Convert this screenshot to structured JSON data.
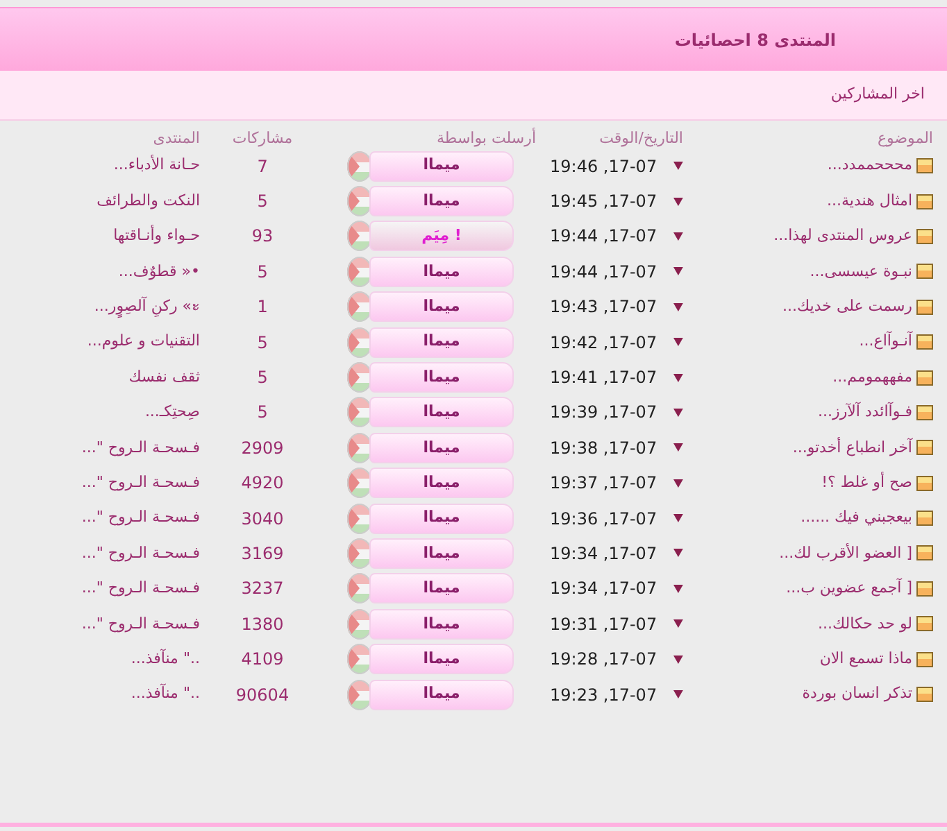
{
  "header": {
    "title": "المنتدى 8 احصائيات"
  },
  "subheader": {
    "title": "اخر المشاركين"
  },
  "table": {
    "columns": [
      "الموضوع",
      "التاريخ/الوقت",
      "أرسلت بواسطة",
      "مشاركات",
      "المنتدى"
    ],
    "rows": [
      {
        "topic": "محححممدد...",
        "date": "19:46 ,17-07",
        "user": {
          "name": "ميماا",
          "kind": "normal"
        },
        "posts": "7",
        "forum": "حـانة الأدباء..."
      },
      {
        "topic": "امثال هندية...",
        "date": "19:45 ,17-07",
        "user": {
          "name": "ميماا",
          "kind": "normal"
        },
        "posts": "5",
        "forum": "النكت والطرائف"
      },
      {
        "topic": "عروس المنتدى لهذا...",
        "date": "19:44 ,17-07",
        "user": {
          "name": "مِيَم !",
          "kind": "alt"
        },
        "posts": "93",
        "forum": "حـواء وأنـاقتها"
      },
      {
        "topic": "نبـوة عيسسى...",
        "date": "19:44 ,17-07",
        "user": {
          "name": "ميماا",
          "kind": "normal"
        },
        "posts": "5",
        "forum": "•« قطوٌف..."
      },
      {
        "topic": "رسمت على خديك...",
        "date": "19:43 ,17-07",
        "user": {
          "name": "ميماا",
          "kind": "normal"
        },
        "posts": "1",
        "forum": "ะ» رکنِ آلصِوٍر..."
      },
      {
        "topic": "آنـوآاع...",
        "date": "19:42 ,17-07",
        "user": {
          "name": "ميماا",
          "kind": "normal"
        },
        "posts": "5",
        "forum": "التقنيات و علوم..."
      },
      {
        "topic": "مفههمومم...",
        "date": "19:41 ,17-07",
        "user": {
          "name": "ميماا",
          "kind": "normal"
        },
        "posts": "5",
        "forum": "ثقف نفسك"
      },
      {
        "topic": "فـوآائدد آلآرز...",
        "date": "19:39 ,17-07",
        "user": {
          "name": "ميماا",
          "kind": "normal"
        },
        "posts": "5",
        "forum": "صِحتِكـ..."
      },
      {
        "topic": "آخر انطباع أخدتو...",
        "date": "19:38 ,17-07",
        "user": {
          "name": "ميماا",
          "kind": "normal"
        },
        "posts": "2909",
        "forum": "فـسحـة الـروح \"..."
      },
      {
        "topic": "صح أو غلط ؟!",
        "date": "19:37 ,17-07",
        "user": {
          "name": "ميماا",
          "kind": "normal"
        },
        "posts": "4920",
        "forum": "فـسحـة الـروح \"..."
      },
      {
        "topic": "بيعجبني فيك ......",
        "date": "19:36 ,17-07",
        "user": {
          "name": "ميماا",
          "kind": "normal"
        },
        "posts": "3040",
        "forum": "فـسحـة الـروح \"..."
      },
      {
        "topic": "[ العضو الأقرب لك...",
        "date": "19:34 ,17-07",
        "user": {
          "name": "ميماا",
          "kind": "normal"
        },
        "posts": "3169",
        "forum": "فـسحـة الـروح \"..."
      },
      {
        "topic": "[ آجمع عضوين ب...",
        "date": "19:34 ,17-07",
        "user": {
          "name": "ميماا",
          "kind": "normal"
        },
        "posts": "3237",
        "forum": "فـسحـة الـروح \"..."
      },
      {
        "topic": "لو حد حكالك...",
        "date": "19:31 ,17-07",
        "user": {
          "name": "ميماا",
          "kind": "normal"
        },
        "posts": "1380",
        "forum": "فـسحـة الـروح \"..."
      },
      {
        "topic": "ماذا تسمع الان",
        "date": "19:28 ,17-07",
        "user": {
          "name": "ميماا",
          "kind": "normal"
        },
        "posts": "4109",
        "forum": "..\" منآفذ..."
      },
      {
        "topic": "تذكر انسان بوردة",
        "date": "19:23 ,17-07",
        "user": {
          "name": "ميماا",
          "kind": "normal"
        },
        "posts": "90604",
        "forum": "..\" منآفذ..."
      }
    ]
  }
}
